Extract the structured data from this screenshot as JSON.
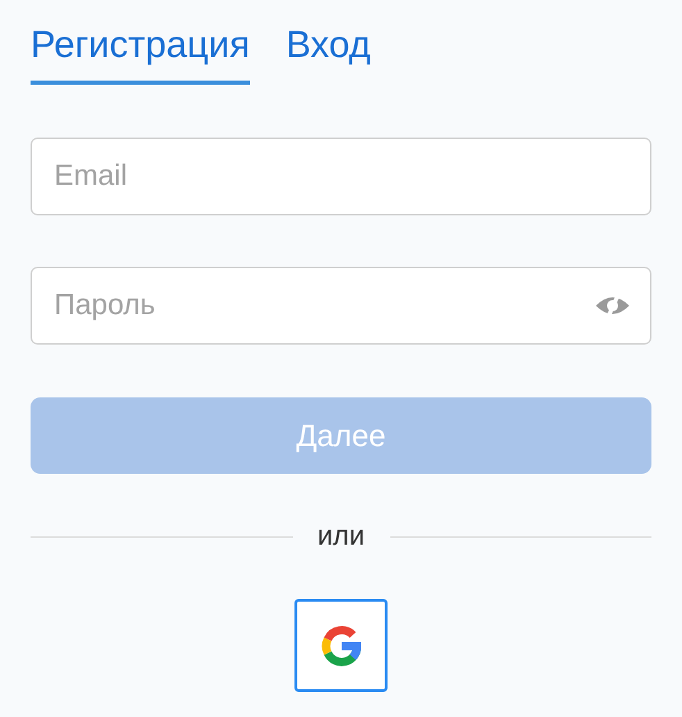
{
  "tabs": [
    {
      "label": "Регистрация",
      "selected": true
    },
    {
      "label": "Вход",
      "selected": false
    }
  ],
  "email": {
    "placeholder": "Email"
  },
  "password": {
    "placeholder": "Пароль",
    "visible": false
  },
  "submit": {
    "label": "Далее",
    "disabled": true
  },
  "divider": "или",
  "social": [
    {
      "kind": "google"
    }
  ]
}
